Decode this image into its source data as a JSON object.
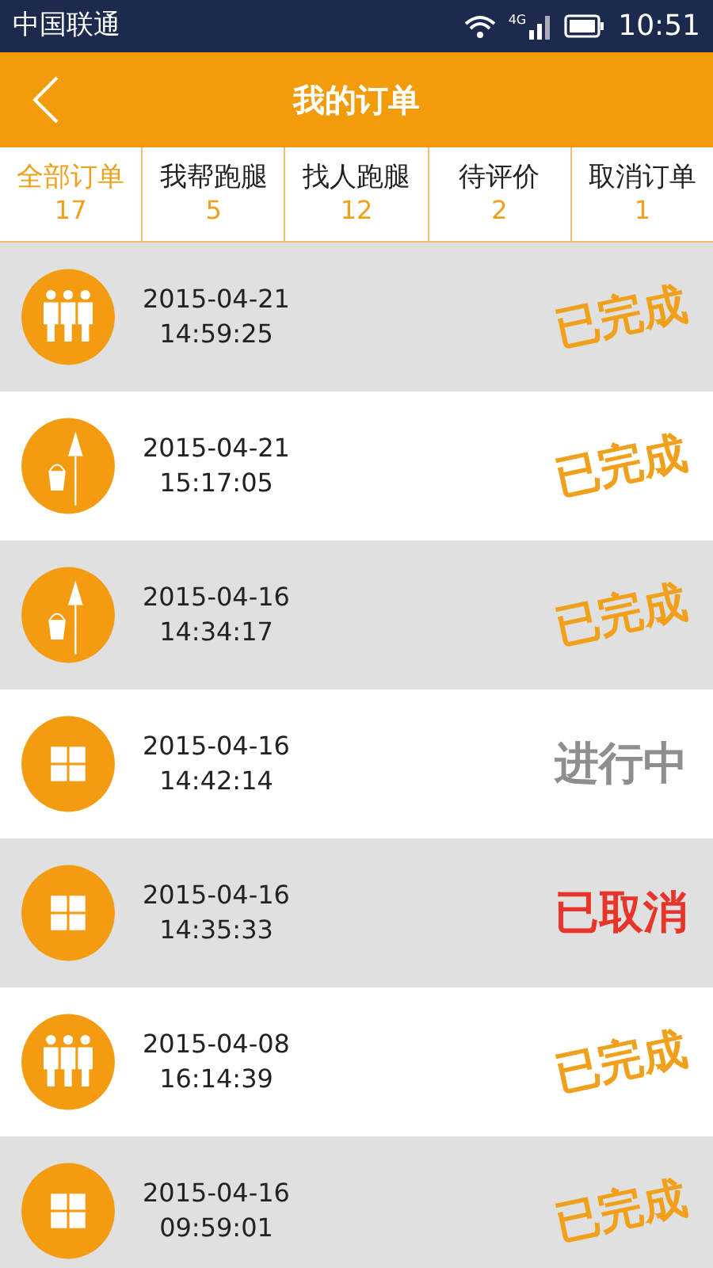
{
  "status_bar": {
    "carrier": "中国联通",
    "network": "4G",
    "time": "10:51"
  },
  "header": {
    "title": "我的订单"
  },
  "tabs": [
    {
      "label": "全部订单",
      "count": "17",
      "selected": true
    },
    {
      "label": "我帮跑腿",
      "count": "5",
      "selected": false
    },
    {
      "label": "找人跑腿",
      "count": "12",
      "selected": false
    },
    {
      "label": "待评价",
      "count": "2",
      "selected": false
    },
    {
      "label": "取消订单",
      "count": "1",
      "selected": false
    }
  ],
  "orders": [
    {
      "kind": "people",
      "date": "2015-04-21",
      "time": "14:59:25",
      "status": {
        "kind": "done",
        "text": "已完成"
      }
    },
    {
      "kind": "cleaning",
      "date": "2015-04-21",
      "time": "15:17:05",
      "status": {
        "kind": "done",
        "text": "已完成"
      }
    },
    {
      "kind": "cleaning",
      "date": "2015-04-16",
      "time": "14:34:17",
      "status": {
        "kind": "done",
        "text": "已完成"
      }
    },
    {
      "kind": "grid",
      "date": "2015-04-16",
      "time": "14:42:14",
      "status": {
        "kind": "active",
        "text": "进行中"
      }
    },
    {
      "kind": "grid",
      "date": "2015-04-16",
      "time": "14:35:33",
      "status": {
        "kind": "cancelled",
        "text": "已取消"
      }
    },
    {
      "kind": "people",
      "date": "2015-04-08",
      "time": "16:14:39",
      "status": {
        "kind": "done",
        "text": "已完成"
      }
    },
    {
      "kind": "grid",
      "date": "2015-04-16",
      "time": "09:59:01",
      "status": {
        "kind": "done",
        "text": "已完成"
      }
    }
  ]
}
